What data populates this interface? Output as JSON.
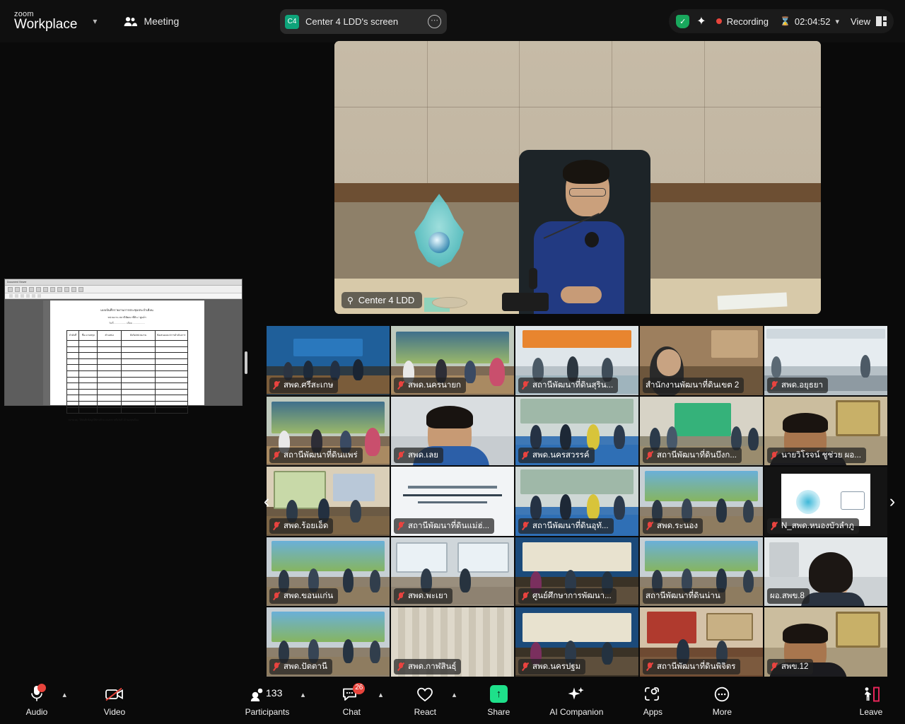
{
  "header": {
    "brand_top": "zoom",
    "brand_bottom": "Workplace",
    "brand_caret_icon": "chevron-down-icon",
    "meeting_label": "Meeting",
    "meeting_icon": "people-icon",
    "share_pill": {
      "avatar_initials": "C4",
      "title": "Center 4 LDD's screen",
      "more_icon": "more-options-icon"
    },
    "status": {
      "shield_icon": "shield-check-icon",
      "ai_icon": "ai-sparkle-icon",
      "recording_label": "Recording",
      "timer_icon": "hourglass-icon",
      "timer": "02:04:52",
      "timer_caret_icon": "chevron-down-icon",
      "view_label": "View",
      "view_icon": "layout-view-icon"
    }
  },
  "shared_screen_thumbnail": {
    "window_title": "Document Viewer",
    "doc_title_line1": "แบบบันทึกรายงานการประชุมประจำเดือน",
    "doc_title_line2": "หน่วยงาน สถานีพัฒนาที่ดิน / ศูนย์ฯ",
    "doc_blank_line": "วันที่ .................. เดือน ..................",
    "columns": [
      "ลำดับที่",
      "ชื่อ-นามสกุล",
      "ตำแหน่ง",
      "สังกัด/หน่วยงาน",
      "ข้อเสนอแนะ/การดำเนินการ"
    ],
    "row_count": 12,
    "footer_note": "หมายเหตุ : ให้บันทึกข้อมูลให้ครบถ้วน และส่งภายในวันที่ 15 ของทุกเดือน"
  },
  "speaker": {
    "name": "Center 4 LDD",
    "pin_icon": "pin-icon"
  },
  "gallery": {
    "prev_icon": "chevron-left-icon",
    "next_icon": "chevron-right-icon",
    "tiles": [
      {
        "name": "สพด.ศรีสะเกษ",
        "muted": true,
        "theme": "blue-room"
      },
      {
        "name": "สพด.นครนายก",
        "muted": true,
        "theme": "mural-room"
      },
      {
        "name": "สถานีพัฒนาที่ดินสุริน...",
        "muted": true,
        "theme": "bright-room"
      },
      {
        "name": "สำนักงานพัฒนาที่ดินเขต 2",
        "muted": false,
        "theme": "office-person"
      },
      {
        "name": "สพด.อยุธยา",
        "muted": true,
        "theme": "white-room"
      },
      {
        "name": "สถานีพัฒนาที่ดินแพร่",
        "muted": true,
        "theme": "mural-room"
      },
      {
        "name": "สพด.เลย",
        "muted": true,
        "theme": "closeup-man"
      },
      {
        "name": "สพด.นครสวรรค์",
        "muted": true,
        "theme": "blue-table"
      },
      {
        "name": "สถานีพัฒนาที่ดินบึงก...",
        "muted": true,
        "theme": "green-room"
      },
      {
        "name": "นายวิโรจน์ ชูช่วย ผอ...",
        "muted": true,
        "theme": "portrait-man"
      },
      {
        "name": "สพด.ร้อยเอ็ด",
        "muted": true,
        "theme": "map-room"
      },
      {
        "name": "สถานีพัฒนาที่ดินแม่ฮ่...",
        "muted": true,
        "theme": "text-slide"
      },
      {
        "name": "สถานีพัฒนาที่ดินอุทั...",
        "muted": true,
        "theme": "blue-table"
      },
      {
        "name": "สพด.ระนอง",
        "muted": true,
        "theme": "scenic-room"
      },
      {
        "name": "N_สพด.หนองบัวลำภู",
        "muted": true,
        "theme": "loading-slide"
      },
      {
        "name": "สพด.ขอนแก่น",
        "muted": true,
        "theme": "scenic-room"
      },
      {
        "name": "สพด.พะเยา",
        "muted": true,
        "theme": "window-room"
      },
      {
        "name": "ศูนย์ศึกษาการพัฒนา...",
        "muted": true,
        "theme": "banner-room"
      },
      {
        "name": "สถานีพัฒนาที่ดินน่าน",
        "muted": false,
        "theme": "scenic-room"
      },
      {
        "name": "ผอ.สพข.8",
        "muted": false,
        "theme": "portrait-woman"
      },
      {
        "name": "สพด.ปัตตานี",
        "muted": true,
        "theme": "scenic-room"
      },
      {
        "name": "สพด.กาฬสินธุ์",
        "muted": true,
        "theme": "curtain-room"
      },
      {
        "name": "สพด.นครปฐม",
        "muted": true,
        "theme": "banner-room"
      },
      {
        "name": "สถานีพัฒนาที่ดินพิจิตร",
        "muted": true,
        "theme": "red-room"
      },
      {
        "name": "สพข.12",
        "muted": true,
        "theme": "portrait-man"
      }
    ]
  },
  "toolbar": {
    "audio": {
      "label": "Audio",
      "icon": "microphone-muted-icon",
      "caret_icon": "chevron-up-icon"
    },
    "video": {
      "label": "Video",
      "icon": "camera-off-icon"
    },
    "participants": {
      "label": "Participants",
      "icon": "participants-icon",
      "count": "133",
      "caret_icon": "chevron-up-icon"
    },
    "chat": {
      "label": "Chat",
      "icon": "chat-icon",
      "badge": "26",
      "caret_icon": "chevron-up-icon"
    },
    "react": {
      "label": "React",
      "icon": "heart-icon",
      "caret_icon": "chevron-up-icon"
    },
    "share": {
      "label": "Share",
      "icon": "share-screen-icon"
    },
    "ai_companion": {
      "label": "AI Companion",
      "icon": "ai-sparkle-icon"
    },
    "apps": {
      "label": "Apps",
      "icon": "apps-icon"
    },
    "more": {
      "label": "More",
      "icon": "more-dots-icon"
    },
    "leave": {
      "label": "Leave",
      "icon": "leave-meeting-icon"
    }
  },
  "colors": {
    "accent_green": "#1ee08a",
    "recording_red": "#e8443c",
    "badge_red": "#e8443c",
    "shield_green": "#19a85d"
  }
}
